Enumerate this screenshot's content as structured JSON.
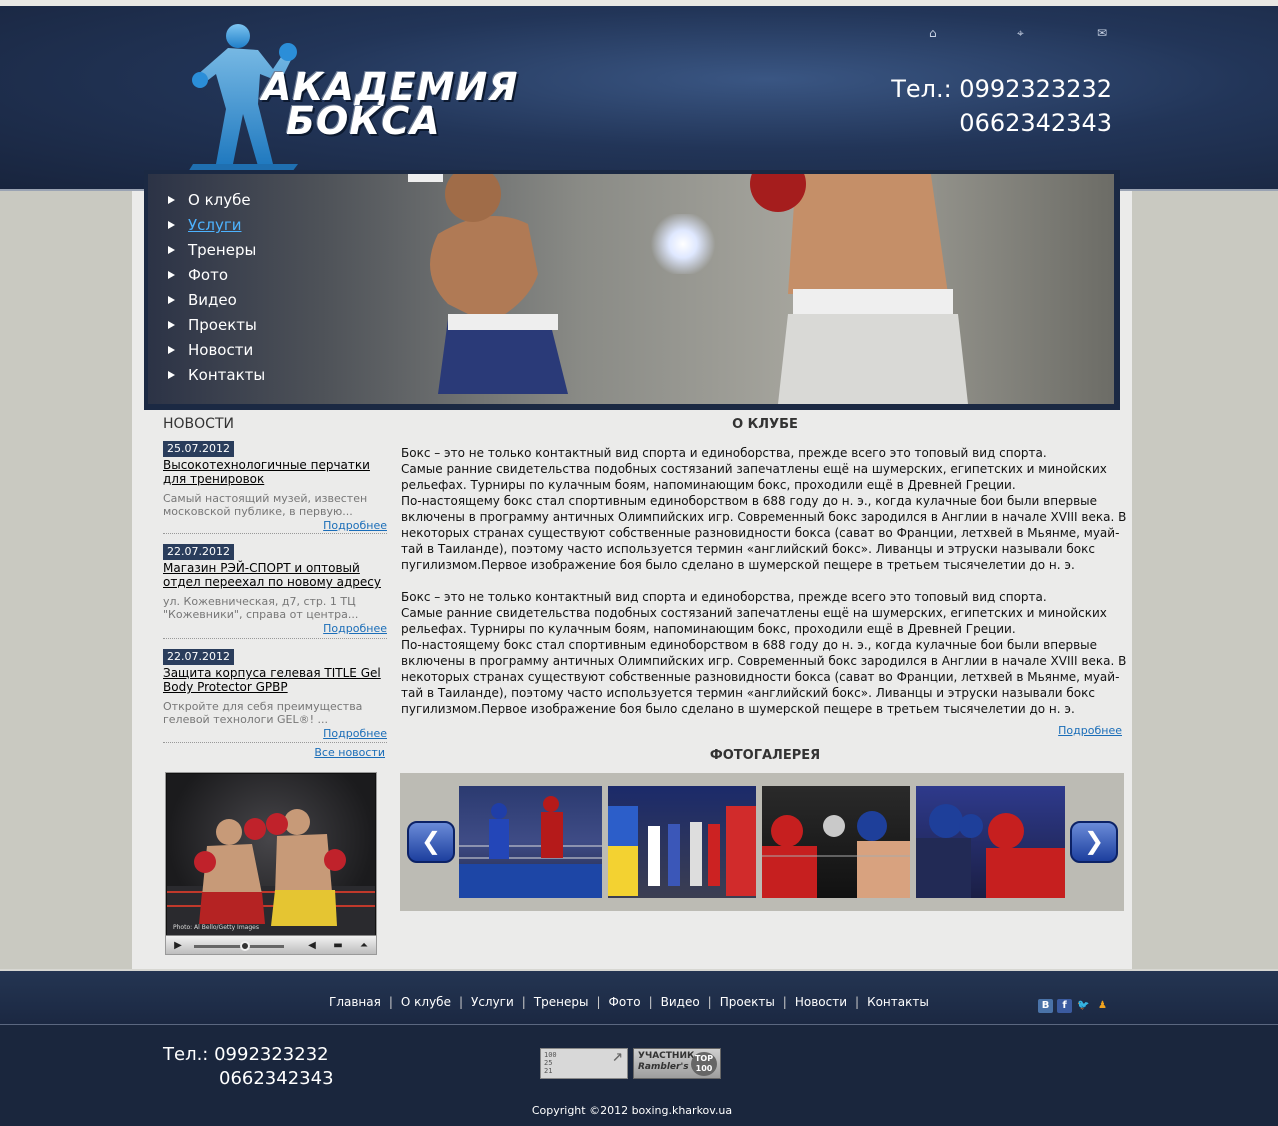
{
  "header": {
    "logo_line1": "АКАДЕМИЯ",
    "logo_line2": "БОКСА",
    "phone_prefix": "Тел.: ",
    "phone1": "0992323232",
    "phone2": "0662342343",
    "icons": [
      "home-icon",
      "sitemap-icon",
      "mail-icon"
    ]
  },
  "menu": {
    "items": [
      {
        "label": "О клубе"
      },
      {
        "label": "Услуги"
      },
      {
        "label": "Тренеры"
      },
      {
        "label": "Фото"
      },
      {
        "label": "Видео"
      },
      {
        "label": "Проекты"
      },
      {
        "label": "Новости"
      },
      {
        "label": "Контакты"
      }
    ],
    "active": "Услуги"
  },
  "news": {
    "title": "НОВОСТИ",
    "more_label": "Подробнее",
    "all_label": "Все новости",
    "items": [
      {
        "date": "25.07.2012",
        "headline": "Высокотехнологичные перчатки для тренировок",
        "desc": "Самый настоящий музей, известен московской публике, в первую..."
      },
      {
        "date": "22.07.2012",
        "headline": "Магазин РЭЙ-СПОРТ и оптовый отдел переехал по новому адресу",
        "desc": "ул. Кожевническая, д7, стр. 1 ТЦ \"Кожевники\", справа от центра..."
      },
      {
        "date": "22.07.2012",
        "headline": "Защита корпуса гелевая TITLE Gel Body Protector GPBP",
        "desc": "Откройте для себя преимущества гелевой технологи GEL®! ..."
      }
    ]
  },
  "video": {
    "credit": "Photo: Al Bello/Getty Images"
  },
  "about": {
    "title": "О КЛУБЕ",
    "paragraphs": [
      " Бокс – это не только контактный вид спорта и единоборства, прежде всего это топовый вид спорта.\nСамые ранние свидетельства подобных состязаний запечатлены ещё на шумерских, египетских и минойских рельефах. Турниры по кулачным боям, напоминающим бокс, проходили ещё в Древней Греции.\nПо-настоящему бокс стал спортивным единоборством в 688 году до н. э., когда кулачные бои были впервые включены в программу античных Олимпийских игр. Современный бокс зародился в Англии в начале XVIII века. В некоторых странах существуют собственные разновидности бокса (сават во Франции, летхвей в Мьянме, муай-тай в Таиланде), поэтому часто используется термин «английский бокс». Ливанцы и этруски называли бокс пугилизмом.Первое изображение боя было сделано в шумерской пещере в третьем тысячелетии до н. э.",
      " Бокс – это не только контактный вид спорта и единоборства, прежде всего это топовый вид спорта.\nСамые ранние свидетельства подобных состязаний запечатлены ещё на шумерских, египетских и минойских рельефах. Турниры по кулачным боям, напоминающим бокс, проходили ещё в Древней Греции.\nПо-настоящему бокс стал спортивным единоборством в 688 году до н. э., когда кулачные бои были впервые включены в программу античных Олимпийских игр. Современный бокс зародился в Англии в начале XVIII века. В некоторых странах существуют собственные разновидности бокса (сават во Франции, летхвей в Мьянме, муай-тай в Таиланде), поэтому часто используется термин «английский бокс». Ливанцы и этруски называли бокс пугилизмом.Первое изображение боя было сделано в шумерской пещере в третьем тысячелетии до н. э."
    ],
    "more_label": "Подробнее"
  },
  "gallery": {
    "title": "ФОТОГАЛЕРЕЯ",
    "prev": "❮",
    "next": "❯"
  },
  "footer": {
    "nav": [
      "Главная",
      "О клубе",
      "Услуги",
      "Тренеры",
      "Фото",
      "Видео",
      "Проекты",
      "Новости",
      "Контакты"
    ],
    "separator": "|",
    "social": [
      "В",
      "f"
    ],
    "phone_prefix": "Тел.: ",
    "phone1": "0992323232",
    "phone2": "0662342343",
    "counter1_lines": [
      "100",
      "25",
      "21"
    ],
    "counter2_label": "УЧАСТНИК",
    "counter2_brand": "Rambler's",
    "counter2_badge": "TOP 100",
    "copyright": "Copyright ©2012 boxing.kharkov.ua"
  },
  "colors": {
    "header_bg": "#223558",
    "accent_link": "#1a6db8",
    "active_menu": "#4db3ff",
    "date_badge": "#2a3d5c",
    "footer_bg": "#1a263d"
  }
}
